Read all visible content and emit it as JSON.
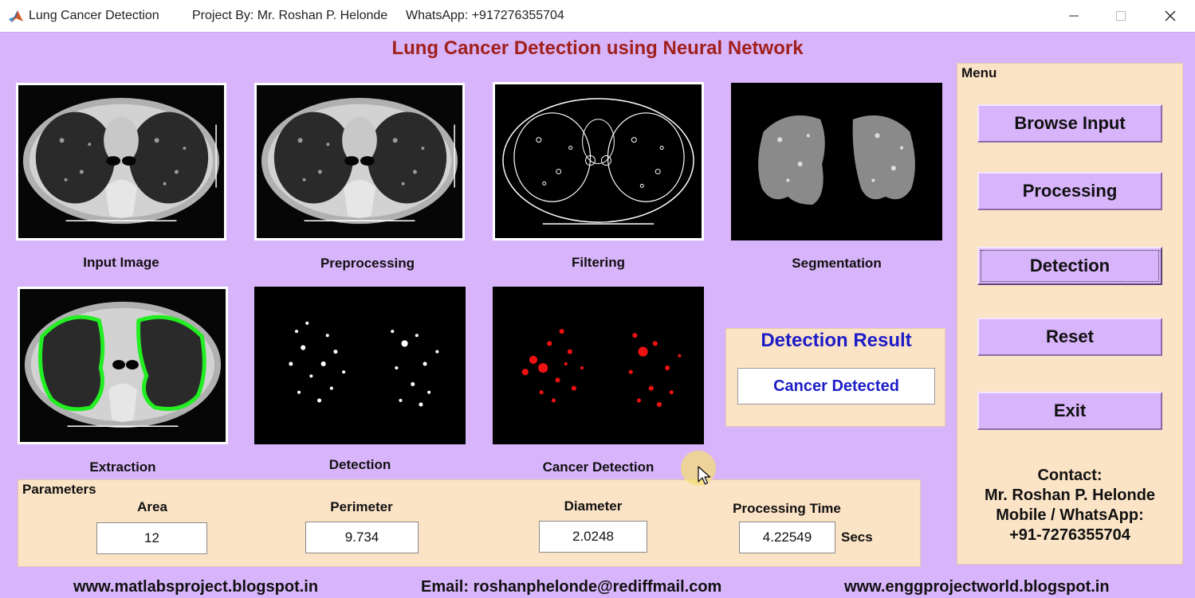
{
  "window": {
    "title": "Lung Cancer Detection",
    "project_by": "Project By: Mr. Roshan P. Helonde",
    "whatsapp": "WhatsApp: +917276355704",
    "icon": "matlab-logo-icon"
  },
  "main_title": "Lung Cancer Detection using Neural Network",
  "images": {
    "input_label": "Input Image",
    "preprocessing_label": "Preprocessing",
    "filtering_label": "Filtering",
    "segmentation_label": "Segmentation",
    "extraction_label": "Extraction",
    "detection_label": "Detection",
    "cancer_detection_label": "Cancer Detection"
  },
  "result": {
    "title": "Detection Result",
    "value": "Cancer Detected"
  },
  "menu": {
    "title": "Menu",
    "browse_label": "Browse Input",
    "processing_label": "Processing",
    "detection_label": "Detection",
    "reset_label": "Reset",
    "exit_label": "Exit"
  },
  "contact": {
    "heading": "Contact:",
    "name": "Mr. Roshan P. Helonde",
    "mobile_label": "Mobile / WhatsApp:",
    "number": "+91-7276355704"
  },
  "parameters": {
    "title": "Parameters",
    "area_label": "Area",
    "area_value": "12",
    "perimeter_label": "Perimeter",
    "perimeter_value": "9.734",
    "diameter_label": "Diameter",
    "diameter_value": "2.0248",
    "time_label": "Processing Time",
    "time_value": "4.22549",
    "time_unit": "Secs"
  },
  "footer": {
    "site1": "www.matlabsproject.blogspot.in",
    "email": "Email: roshanphelonde@rediffmail.com",
    "site2": "www.enggprojectworld.blogspot.in"
  },
  "colors": {
    "background": "#d8b4fb",
    "panel": "#fbe3c6",
    "title": "#a0201c",
    "result_text": "#1d1dc7",
    "contour": "#22ee22",
    "tumor": "#ee1111"
  }
}
